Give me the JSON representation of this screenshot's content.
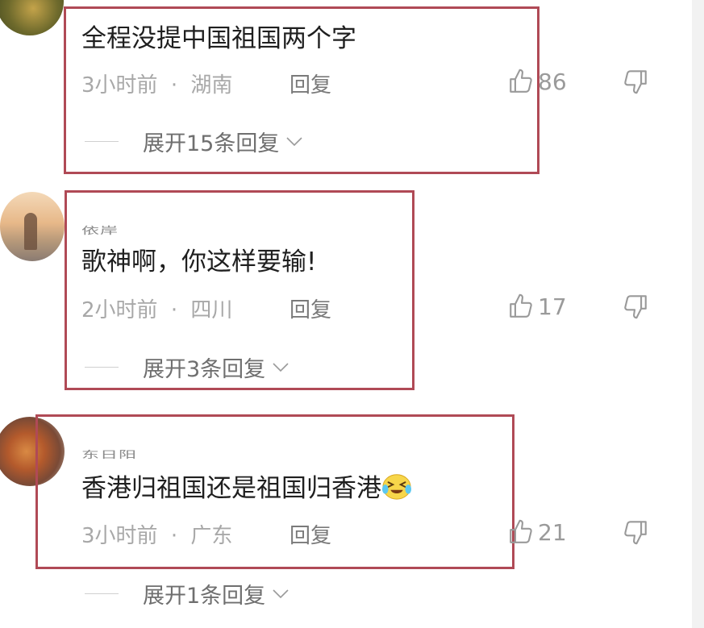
{
  "comments": [
    {
      "username": "",
      "text": "全程没提中国祖国两个字",
      "time": "3小时前",
      "separator": "·",
      "location": "湖南",
      "reply_label": "回复",
      "likes": "86",
      "expand_label": "展开15条回复"
    },
    {
      "username": "依岸",
      "text": "歌神啊，你这样要输!",
      "time": "2小时前",
      "separator": "·",
      "location": "四川",
      "reply_label": "回复",
      "likes": "17",
      "expand_label": "展开3条回复"
    },
    {
      "username": "东日阳",
      "text": "香港归祖国还是祖国归香港",
      "emoji": "laughing-tears-emoji",
      "time": "3小时前",
      "separator": "·",
      "location": "广东",
      "reply_label": "回复",
      "likes": "21",
      "expand_label": "展开1条回复"
    }
  ],
  "colors": {
    "highlight_border": "#b04a56",
    "text_primary": "#1f1f1f",
    "text_meta": "#a8a8a8",
    "icon_gray": "#9a9a9a"
  },
  "icons": [
    "thumbs-up-icon",
    "thumbs-down-icon",
    "chevron-down-icon"
  ]
}
